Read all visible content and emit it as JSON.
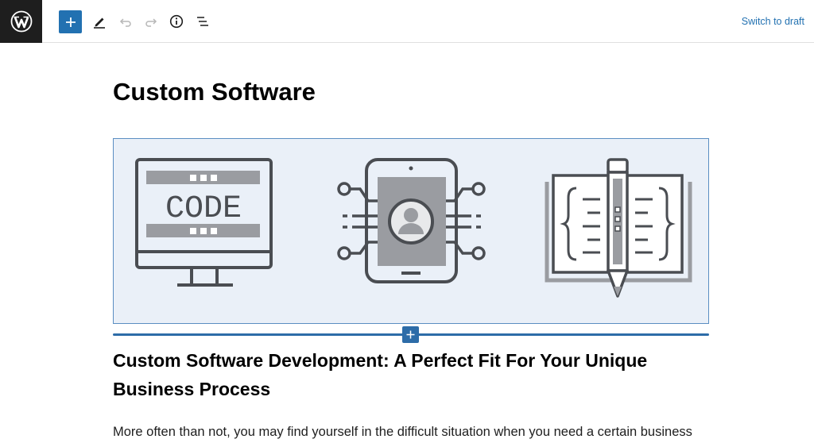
{
  "toolbar": {
    "logo_icon": "wordpress-logo-icon",
    "add_icon": "plus-icon",
    "edit_icon": "pencil-icon",
    "undo_icon": "undo-icon",
    "redo_icon": "redo-icon",
    "info_icon": "info-icon",
    "outline_icon": "list-view-icon",
    "switch_draft_label": "Switch to draft"
  },
  "editor": {
    "post_title": "Custom Software",
    "image": {
      "code_label": "CODE",
      "illustrations": [
        "monitor-code-icon",
        "tablet-network-user-icon",
        "open-book-pencil-icon"
      ]
    },
    "inserter_icon": "plus-icon",
    "heading": "Custom Software Development: A Perfect Fit For Your Unique Business Process",
    "paragraph": "More often than not, you may find yourself in the difficult situation when you need a certain business"
  },
  "colors": {
    "accent": "#2271b1",
    "image_bg": "#eaf0f8",
    "icon_dark": "#4a4d52",
    "icon_gray": "#9a9ca1"
  }
}
